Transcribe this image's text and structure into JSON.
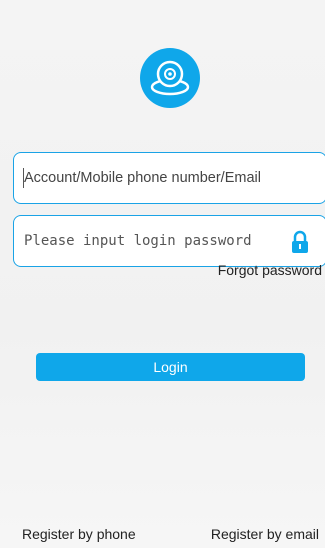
{
  "app": {
    "logo_icon": "camera-icon",
    "accent_color": "#0fa7ea"
  },
  "login_form": {
    "account_placeholder": "Account/Mobile phone number/Email",
    "password_placeholder": "Please input login password",
    "lock_icon": "lock-icon",
    "forgot_label": "Forgot password",
    "login_label": "Login"
  },
  "footer": {
    "register_phone_label": "Register by phone",
    "register_email_label": "Register by email"
  }
}
